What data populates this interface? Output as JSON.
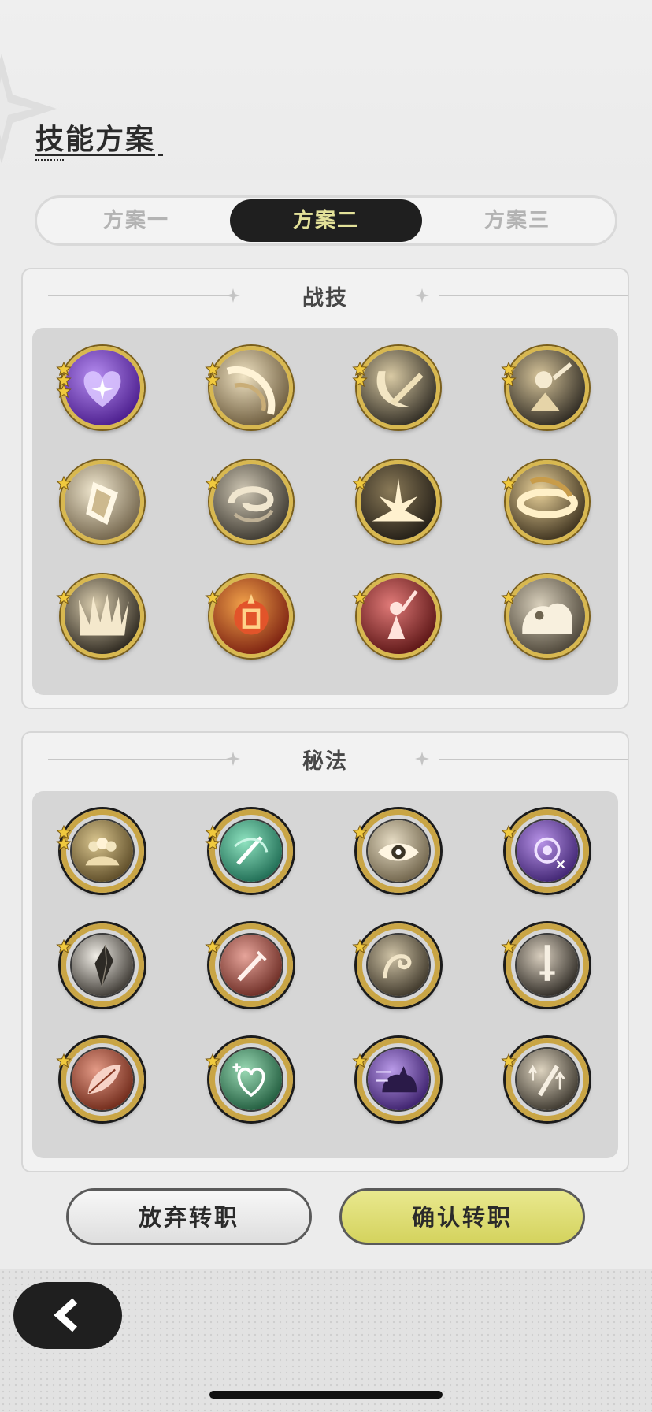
{
  "page_title": "技能方案",
  "tabs": [
    {
      "label": "方案一",
      "active": false
    },
    {
      "label": "方案二",
      "active": true
    },
    {
      "label": "方案三",
      "active": false
    }
  ],
  "skills_panel": {
    "title": "战技",
    "items": [
      {
        "name": "purple-heart-burst-icon",
        "stars": 3
      },
      {
        "name": "golden-slash-wind-icon",
        "stars": 2
      },
      {
        "name": "crescent-sword-icon",
        "stars": 2
      },
      {
        "name": "figure-sword-strike-icon",
        "stars": 2
      },
      {
        "name": "shining-shield-icon",
        "stars": 1
      },
      {
        "name": "swirl-wind-icon",
        "stars": 1
      },
      {
        "name": "ground-explosion-icon",
        "stars": 1
      },
      {
        "name": "golden-ring-icon",
        "stars": 1
      },
      {
        "name": "spike-burst-icon",
        "stars": 1
      },
      {
        "name": "flame-rune-icon",
        "stars": 1
      },
      {
        "name": "red-figure-sword-icon",
        "stars": 1
      },
      {
        "name": "charging-beast-icon",
        "stars": 1
      }
    ]
  },
  "secrets_panel": {
    "title": "秘法",
    "items": [
      {
        "name": "group-figures-icon",
        "stars": 2
      },
      {
        "name": "green-sword-slash-icon",
        "stars": 2
      },
      {
        "name": "eye-icon",
        "stars": 1
      },
      {
        "name": "purple-flower-icon",
        "stars": 1
      },
      {
        "name": "crystal-shard-icon",
        "stars": 1
      },
      {
        "name": "red-sword-icon",
        "stars": 1
      },
      {
        "name": "wind-spirit-icon",
        "stars": 1
      },
      {
        "name": "sword-upgrade-icon",
        "stars": 1
      },
      {
        "name": "red-feather-icon",
        "stars": 1
      },
      {
        "name": "green-heart-heal-icon",
        "stars": 1
      },
      {
        "name": "purple-cat-icon",
        "stars": 1
      },
      {
        "name": "sword-arrows-up-icon",
        "stars": 1
      }
    ]
  },
  "buttons": {
    "abandon": "放弃转职",
    "confirm": "确认转职"
  },
  "colors": {
    "gold_border": "#d8b850",
    "tab_active_bg": "#1f1f1f",
    "tab_active_text": "#e3e199",
    "confirm_bg": "#d9d865"
  },
  "back_icon": "chevron-left-icon"
}
